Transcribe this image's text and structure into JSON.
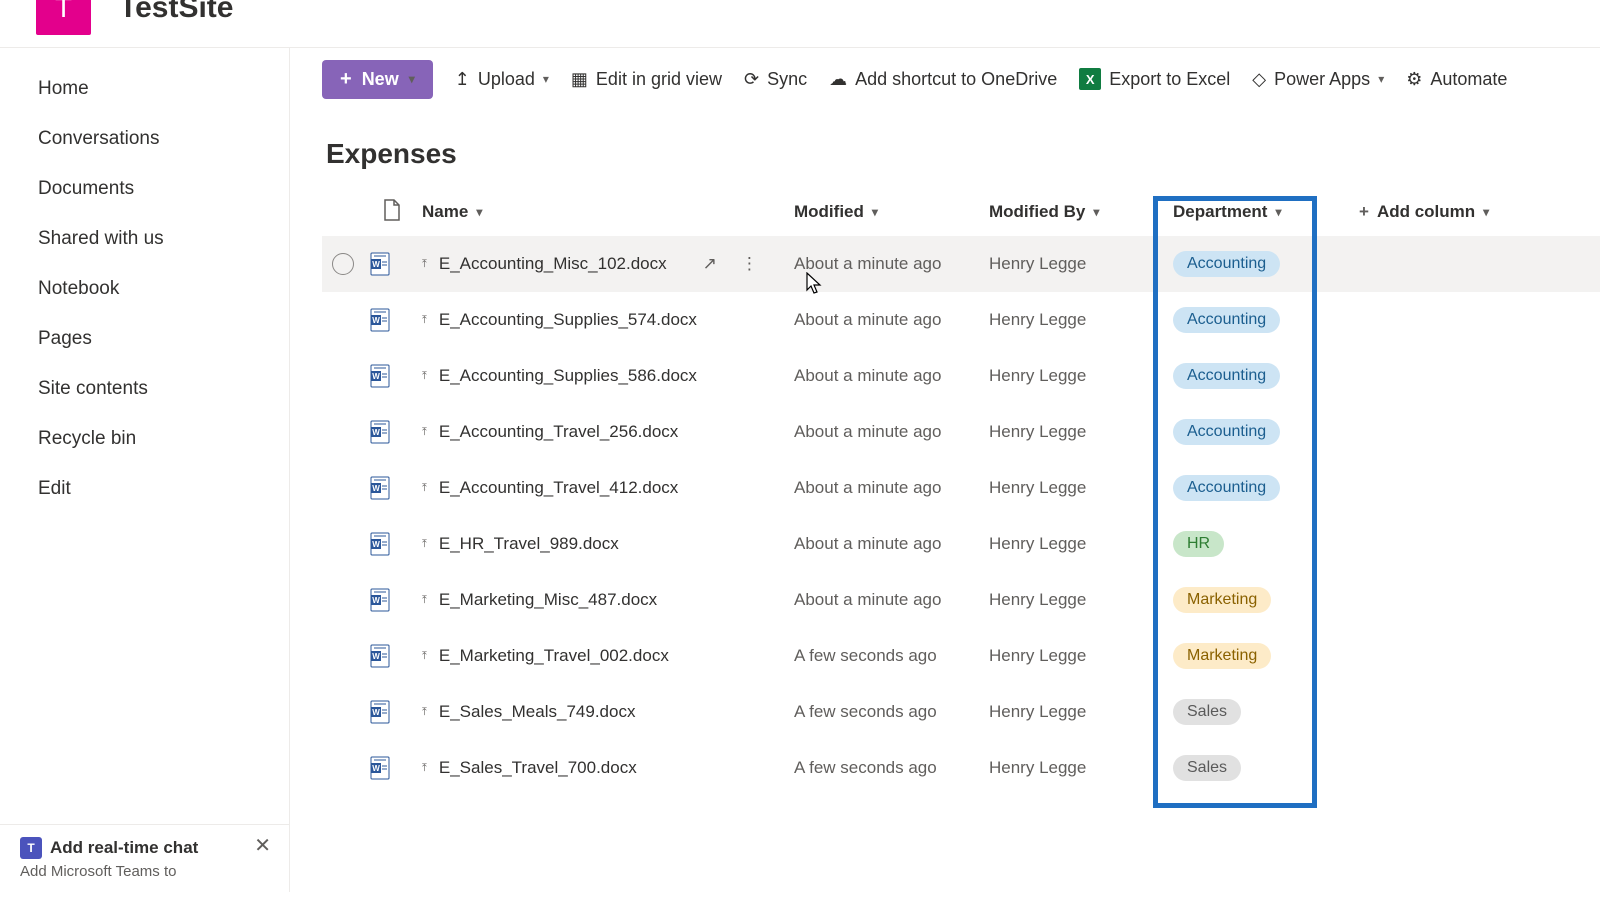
{
  "site": {
    "initial": "T",
    "title": "TestSite"
  },
  "nav": {
    "items": [
      "Home",
      "Conversations",
      "Documents",
      "Shared with us",
      "Notebook",
      "Pages",
      "Site contents",
      "Recycle bin",
      "Edit"
    ]
  },
  "teams_promo": {
    "title": "Add real-time chat",
    "subtitle": "Add Microsoft Teams to"
  },
  "cmdbar": {
    "new": "New",
    "upload": "Upload",
    "edit_grid": "Edit in grid view",
    "sync": "Sync",
    "shortcut": "Add shortcut to OneDrive",
    "export": "Export to Excel",
    "powerapps": "Power Apps",
    "automate": "Automate"
  },
  "list": {
    "title": "Expenses",
    "columns": {
      "name": "Name",
      "modified": "Modified",
      "modified_by": "Modified By",
      "department": "Department",
      "add": "Add column"
    },
    "rows": [
      {
        "name": "E_Accounting_Misc_102.docx",
        "modified": "About a minute ago",
        "modified_by": "Henry Legge",
        "department": "Accounting",
        "hover": true
      },
      {
        "name": "E_Accounting_Supplies_574.docx",
        "modified": "About a minute ago",
        "modified_by": "Henry Legge",
        "department": "Accounting"
      },
      {
        "name": "E_Accounting_Supplies_586.docx",
        "modified": "About a minute ago",
        "modified_by": "Henry Legge",
        "department": "Accounting"
      },
      {
        "name": "E_Accounting_Travel_256.docx",
        "modified": "About a minute ago",
        "modified_by": "Henry Legge",
        "department": "Accounting"
      },
      {
        "name": "E_Accounting_Travel_412.docx",
        "modified": "About a minute ago",
        "modified_by": "Henry Legge",
        "department": "Accounting"
      },
      {
        "name": "E_HR_Travel_989.docx",
        "modified": "About a minute ago",
        "modified_by": "Henry Legge",
        "department": "HR"
      },
      {
        "name": "E_Marketing_Misc_487.docx",
        "modified": "About a minute ago",
        "modified_by": "Henry Legge",
        "department": "Marketing"
      },
      {
        "name": "E_Marketing_Travel_002.docx",
        "modified": "A few seconds ago",
        "modified_by": "Henry Legge",
        "department": "Marketing"
      },
      {
        "name": "E_Sales_Meals_749.docx",
        "modified": "A few seconds ago",
        "modified_by": "Henry Legge",
        "department": "Sales"
      },
      {
        "name": "E_Sales_Travel_700.docx",
        "modified": "A few seconds ago",
        "modified_by": "Henry Legge",
        "department": "Sales"
      }
    ]
  },
  "highlight": {
    "column": "department"
  }
}
